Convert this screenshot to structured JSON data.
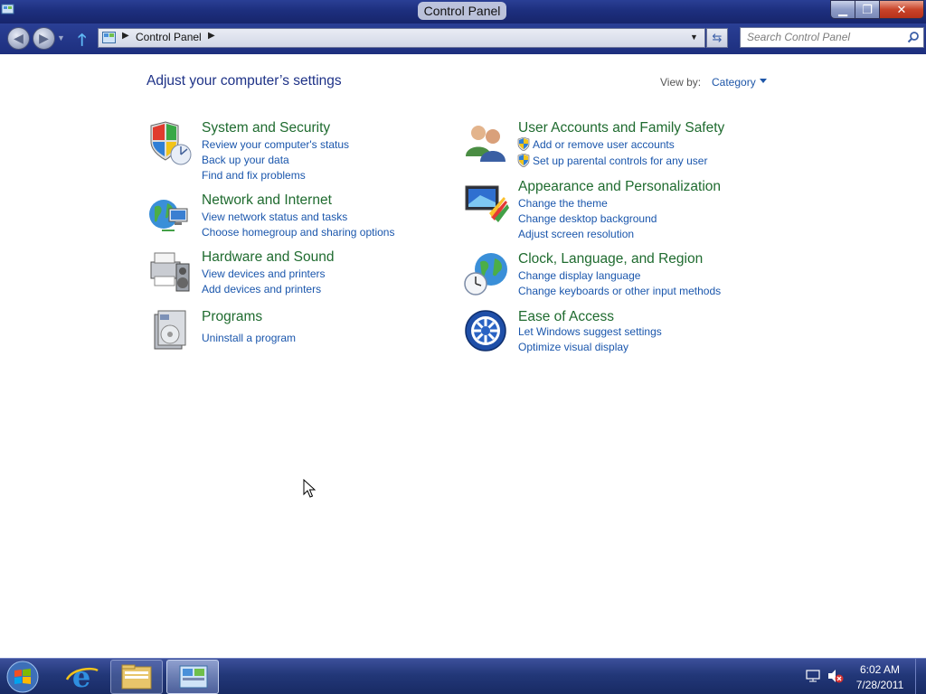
{
  "window": {
    "title": "Control Panel",
    "min_symbol": "▁",
    "max_symbol": "❐",
    "close_symbol": "✕"
  },
  "nav": {
    "back_symbol": "◀",
    "forward_symbol": "▶",
    "breadcrumb": "Control Panel",
    "search_placeholder": "Search Control Panel"
  },
  "content": {
    "heading": "Adjust your computer’s settings",
    "view_by_label": "View by:",
    "view_by_value": "Category"
  },
  "categories": [
    {
      "title": "System and Security",
      "icon": "system-security-icon",
      "links": [
        "Review your computer's status",
        "Back up your data",
        "Find and fix problems"
      ]
    },
    {
      "title": "Network and Internet",
      "icon": "network-internet-icon",
      "links": [
        "View network status and tasks",
        "Choose homegroup and sharing options"
      ]
    },
    {
      "title": "Hardware and Sound",
      "icon": "hardware-sound-icon",
      "links": [
        "View devices and printers",
        "Add devices and printers"
      ]
    },
    {
      "title": "Programs",
      "icon": "programs-icon",
      "links": [
        "Uninstall a program"
      ]
    },
    {
      "title": "User Accounts and Family Safety",
      "icon": "user-accounts-icon",
      "links": [
        "Add or remove user accounts",
        "Set up parental controls for any user"
      ]
    },
    {
      "title": "Appearance and Personalization",
      "icon": "appearance-icon",
      "links": [
        "Change the theme",
        "Change desktop background",
        "Adjust screen resolution"
      ]
    },
    {
      "title": "Clock, Language, and Region",
      "icon": "clock-language-icon",
      "links": [
        "Change display language",
        "Change keyboards or other input methods"
      ]
    },
    {
      "title": "Ease of Access",
      "icon": "ease-of-access-icon",
      "links": [
        "Let Windows suggest settings",
        "Optimize visual display"
      ]
    }
  ],
  "taskbar": {
    "time": "6:02 AM",
    "date": "7/28/2011"
  }
}
